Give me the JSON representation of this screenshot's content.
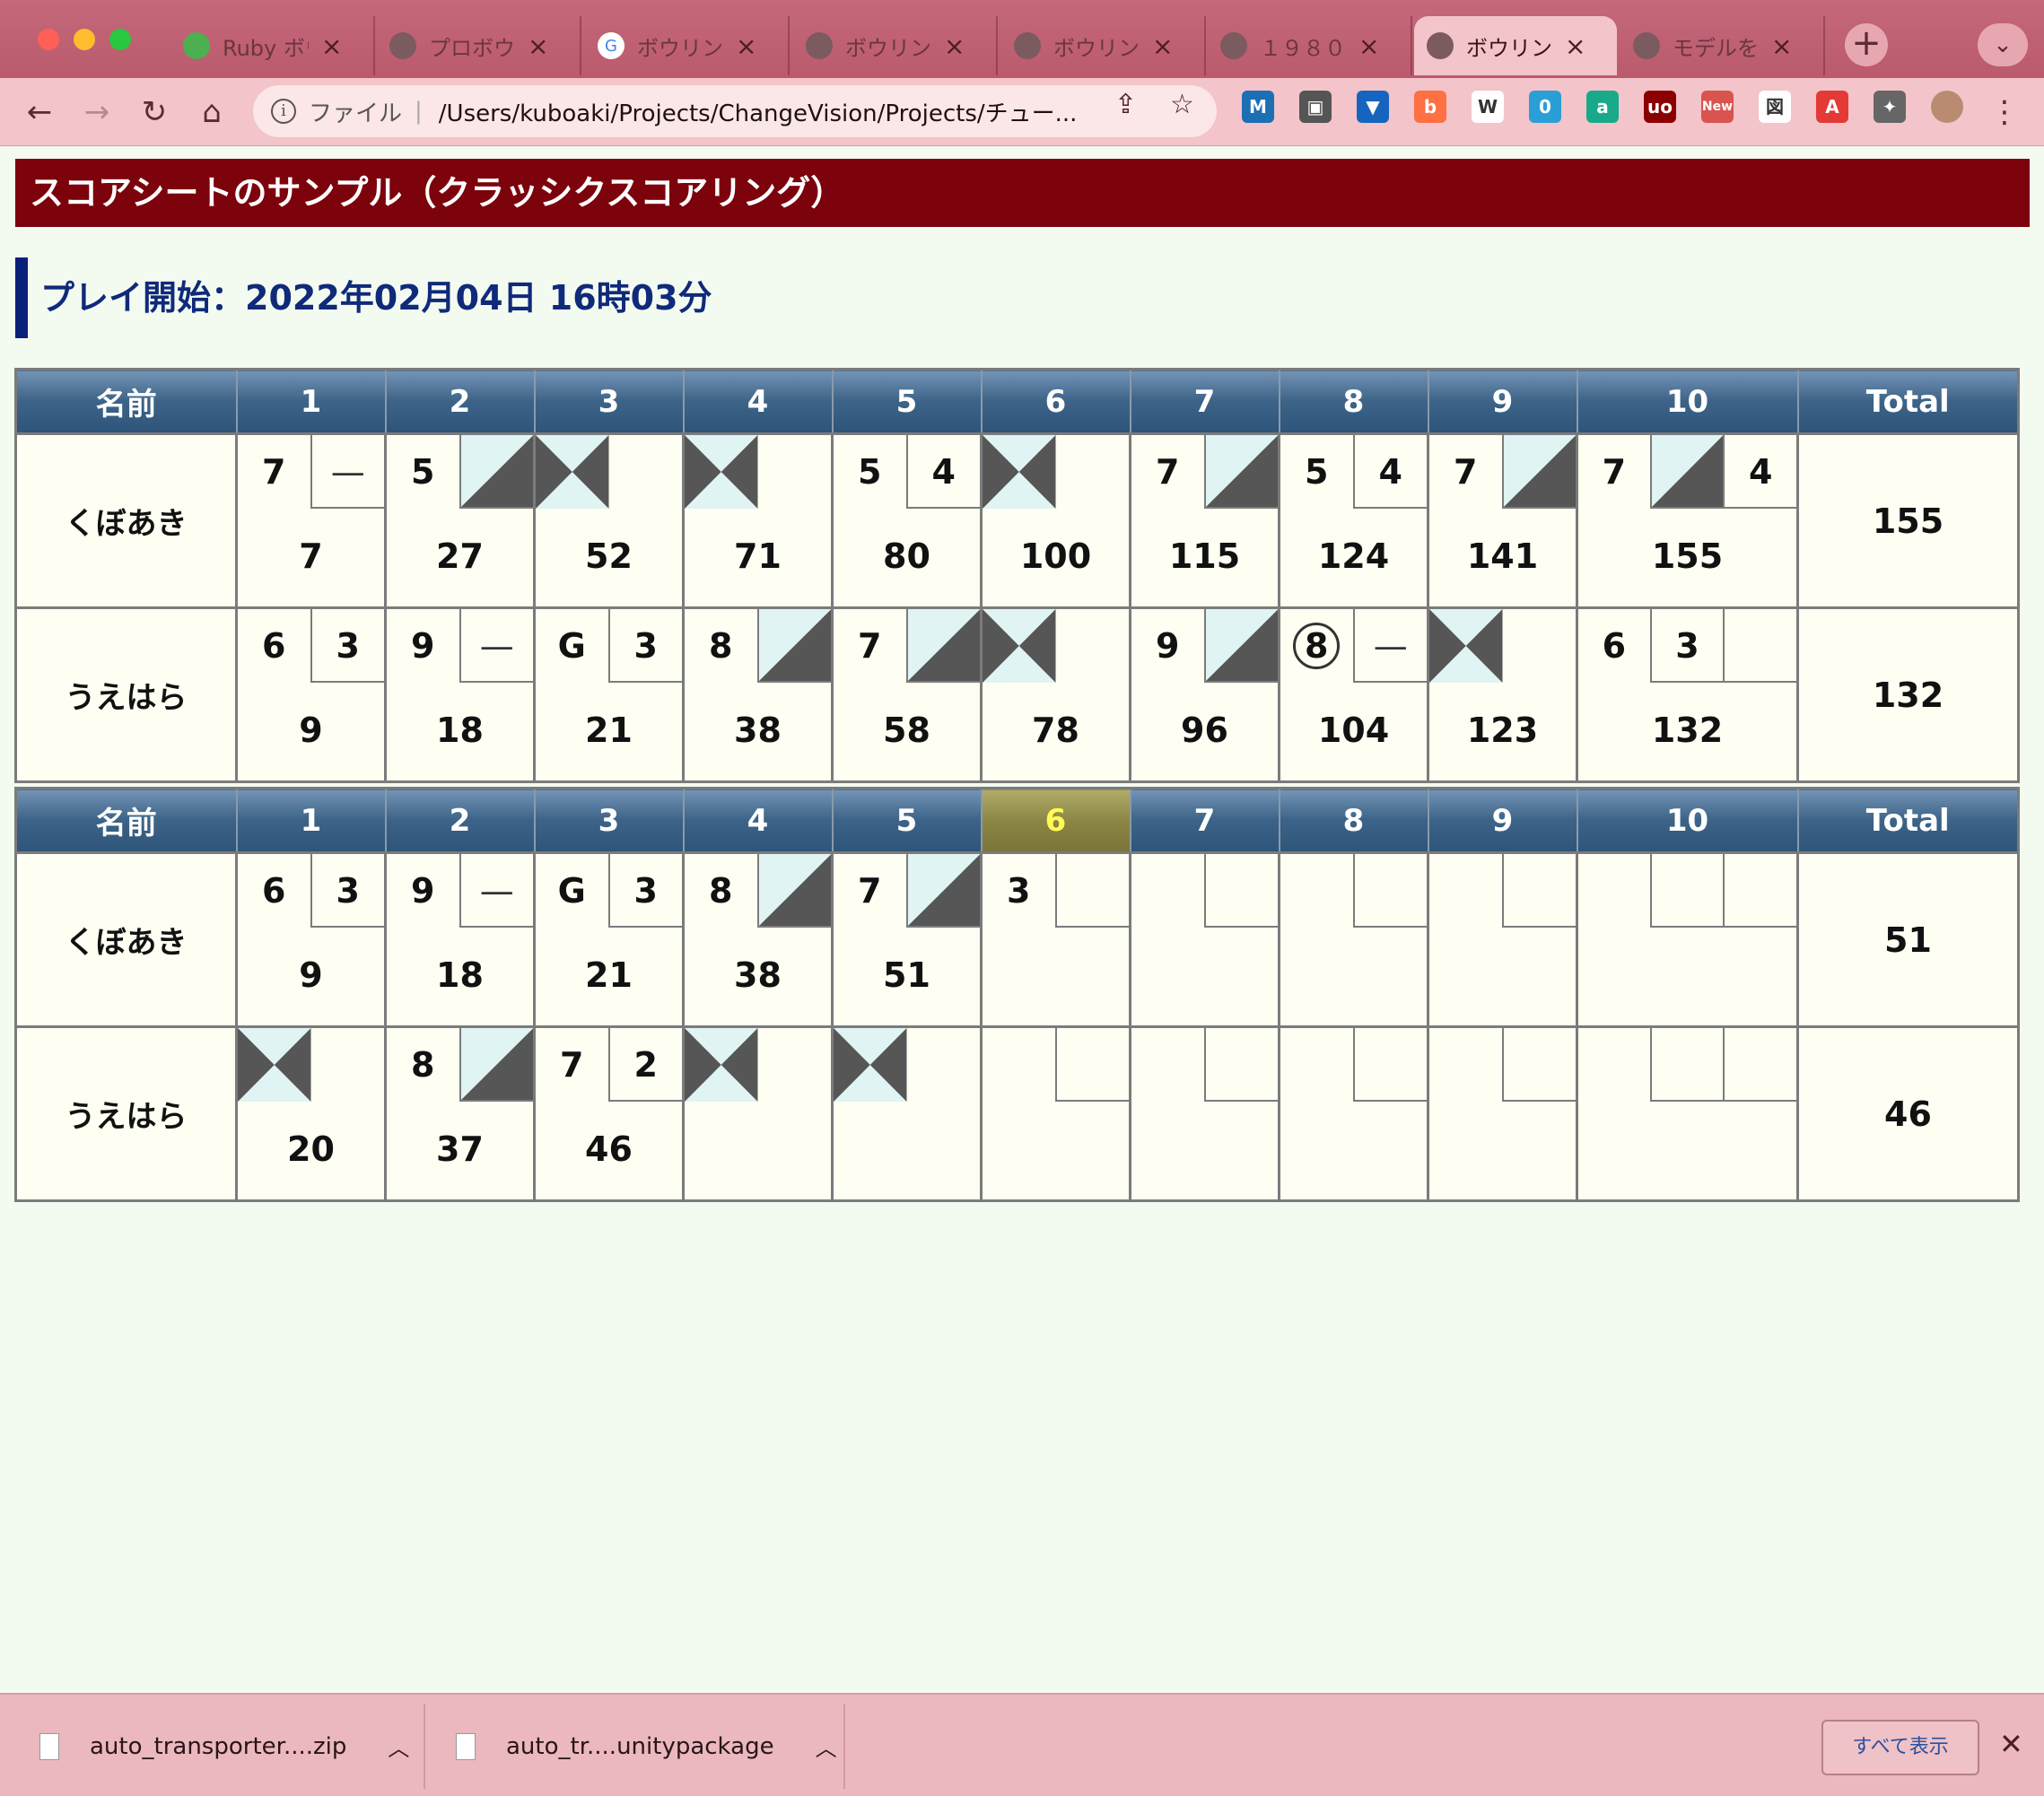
{
  "browser": {
    "tabs": [
      {
        "label": "Ruby ボウ",
        "icon": "ruby-icon"
      },
      {
        "label": "プロボウラ",
        "icon": "globe-icon"
      },
      {
        "label": "ボウリング",
        "icon": "google-icon"
      },
      {
        "label": "ボウリング",
        "icon": "globe-icon"
      },
      {
        "label": "ボウリング",
        "icon": "image-icon"
      },
      {
        "label": "１９８０",
        "icon": "globe-icon"
      },
      {
        "label": "ボウリング",
        "icon": "globe-icon"
      },
      {
        "label": "モデルを作",
        "icon": "globe-icon"
      }
    ],
    "active_tab": 6,
    "address": {
      "scheme": "ファイル",
      "url": "/Users/kuboaki/Projects/ChangeVision/Projects/チュー..."
    },
    "extensions": [
      "M",
      "▣",
      "▼",
      "b",
      "W",
      "0",
      "a",
      "uo",
      "New",
      "図",
      "A",
      "✦"
    ],
    "colors": {
      "tabbar": "#c4687a",
      "toolbar": "#f3c4c9"
    }
  },
  "page": {
    "header": "スコアシートのサンプル（クラッシクスコアリング）",
    "play_start": "プレイ開始：2022年02月04日 16時03分",
    "colors": {
      "header_bg": "#7c020c",
      "accent": "#0a1f7a",
      "cell_bg": "#fffef2",
      "strike_light": "#dff4f3",
      "strike_dark": "#565656",
      "current_frame": "#8c8645"
    }
  },
  "games": [
    {
      "headers": {
        "name": "名前",
        "frames": [
          "1",
          "2",
          "3",
          "4",
          "5",
          "6",
          "7",
          "8",
          "9",
          "10"
        ],
        "total": "Total"
      },
      "current_frame": null,
      "players": [
        {
          "name": "くぼあき",
          "total": "155",
          "frames": [
            {
              "b": [
                "7",
                "—"
              ],
              "cum": "7"
            },
            {
              "b": [
                "5",
                "/"
              ],
              "cum": "27"
            },
            {
              "b": [
                "X",
                ""
              ],
              "cum": "52"
            },
            {
              "b": [
                "X",
                ""
              ],
              "cum": "71"
            },
            {
              "b": [
                "5",
                "4"
              ],
              "cum": "80"
            },
            {
              "b": [
                "X",
                ""
              ],
              "cum": "100"
            },
            {
              "b": [
                "7",
                "/"
              ],
              "cum": "115"
            },
            {
              "b": [
                "5",
                "4"
              ],
              "cum": "124"
            },
            {
              "b": [
                "7",
                "/"
              ],
              "cum": "141"
            },
            {
              "b": [
                "7",
                "/",
                "4"
              ],
              "cum": "155"
            }
          ]
        },
        {
          "name": "うえはら",
          "total": "132",
          "frames": [
            {
              "b": [
                "6",
                "3"
              ],
              "cum": "9"
            },
            {
              "b": [
                "9",
                "—"
              ],
              "cum": "18"
            },
            {
              "b": [
                "G",
                "3"
              ],
              "cum": "21"
            },
            {
              "b": [
                "8",
                "/"
              ],
              "cum": "38"
            },
            {
              "b": [
                "7",
                "/"
              ],
              "cum": "58"
            },
            {
              "b": [
                "X",
                ""
              ],
              "cum": "78"
            },
            {
              "b": [
                "9",
                "/"
              ],
              "cum": "96"
            },
            {
              "b": [
                "8",
                "—"
              ],
              "split": true,
              "cum": "104"
            },
            {
              "b": [
                "X",
                ""
              ],
              "cum": "123"
            },
            {
              "b": [
                "6",
                "3",
                ""
              ],
              "cum": "132"
            }
          ]
        }
      ]
    },
    {
      "headers": {
        "name": "名前",
        "frames": [
          "1",
          "2",
          "3",
          "4",
          "5",
          "6",
          "7",
          "8",
          "9",
          "10"
        ],
        "total": "Total"
      },
      "current_frame": 6,
      "players": [
        {
          "name": "くぼあき",
          "total": "51",
          "frames": [
            {
              "b": [
                "6",
                "3"
              ],
              "cum": "9"
            },
            {
              "b": [
                "9",
                "—"
              ],
              "cum": "18"
            },
            {
              "b": [
                "G",
                "3"
              ],
              "cum": "21"
            },
            {
              "b": [
                "8",
                "/"
              ],
              "cum": "38"
            },
            {
              "b": [
                "7",
                "/"
              ],
              "cum": "51"
            },
            {
              "b": [
                "3",
                ""
              ],
              "cum": ""
            },
            {
              "b": [
                "",
                ""
              ],
              "cum": ""
            },
            {
              "b": [
                "",
                ""
              ],
              "cum": ""
            },
            {
              "b": [
                "",
                ""
              ],
              "cum": ""
            },
            {
              "b": [
                "",
                "",
                ""
              ],
              "cum": ""
            }
          ]
        },
        {
          "name": "うえはら",
          "total": "46",
          "frames": [
            {
              "b": [
                "X",
                ""
              ],
              "cum": "20"
            },
            {
              "b": [
                "8",
                "/"
              ],
              "cum": "37"
            },
            {
              "b": [
                "7",
                "2"
              ],
              "cum": "46"
            },
            {
              "b": [
                "X",
                ""
              ],
              "cum": ""
            },
            {
              "b": [
                "X",
                ""
              ],
              "cum": ""
            },
            {
              "b": [
                "",
                ""
              ],
              "cum": ""
            },
            {
              "b": [
                "",
                ""
              ],
              "cum": ""
            },
            {
              "b": [
                "",
                ""
              ],
              "cum": ""
            },
            {
              "b": [
                "",
                ""
              ],
              "cum": ""
            },
            {
              "b": [
                "",
                "",
                ""
              ],
              "cum": ""
            }
          ]
        }
      ]
    }
  ],
  "downloads": {
    "items": [
      {
        "filename": "auto_transporter....zip"
      },
      {
        "filename": "auto_tr....unitypackage"
      }
    ],
    "show_all": "すべて表示"
  }
}
